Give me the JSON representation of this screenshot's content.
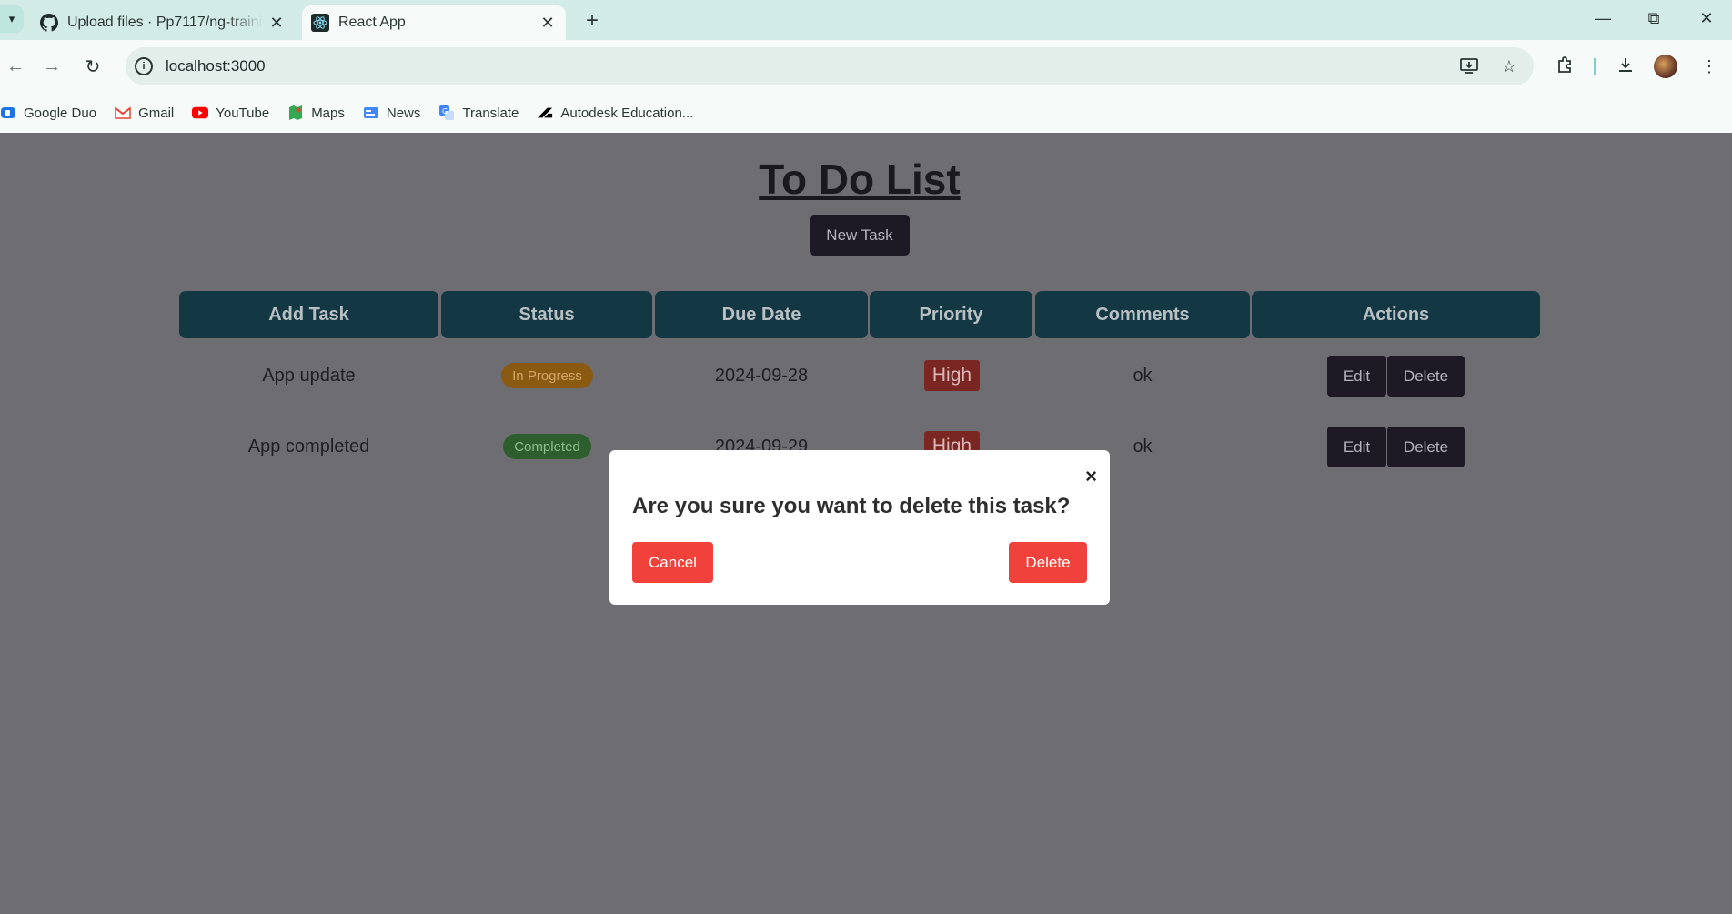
{
  "browser": {
    "tabs": [
      {
        "title": "Upload files · Pp7117/ng-trainin",
        "icon": "github-icon",
        "active": false
      },
      {
        "title": "React App",
        "icon": "react-icon",
        "active": true
      }
    ],
    "url": "localhost:3000",
    "bookmarks": [
      {
        "label": "Google Duo",
        "icon": "google-duo-icon",
        "color": "#1a73e8"
      },
      {
        "label": "Gmail",
        "icon": "gmail-icon",
        "color": "#ea4335"
      },
      {
        "label": "YouTube",
        "icon": "youtube-icon",
        "color": "#ff0000"
      },
      {
        "label": "Maps",
        "icon": "maps-icon",
        "color": "#34a853"
      },
      {
        "label": "News",
        "icon": "news-icon",
        "color": "#4285f4"
      },
      {
        "label": "Translate",
        "icon": "translate-icon",
        "color": "#4285f4"
      },
      {
        "label": "Autodesk Education...",
        "icon": "autodesk-icon",
        "color": "#000000"
      }
    ]
  },
  "app": {
    "title": "To Do List",
    "new_task_label": "New Task",
    "columns": [
      "Add Task",
      "Status",
      "Due Date",
      "Priority",
      "Comments",
      "Actions"
    ],
    "rows": [
      {
        "task": "App update",
        "status": "In Progress",
        "due": "2024-09-28",
        "priority": "High",
        "comments": "ok",
        "edit": "Edit",
        "delete": "Delete"
      },
      {
        "task": "App completed",
        "status": "Completed",
        "due": "2024-09-29",
        "priority": "High",
        "comments": "ok",
        "edit": "Edit",
        "delete": "Delete"
      }
    ]
  },
  "modal": {
    "close": "×",
    "message": "Are you sure you want to delete this task?",
    "cancel_label": "Cancel",
    "delete_label": "Delete"
  },
  "colors": {
    "overlay_bg": "#6e6e72",
    "header_bg": "#143744",
    "button_dark": "#1d1a26",
    "modal_button": "#f0413a",
    "status_in_progress": "#8a5a12",
    "status_completed": "#2e5e2e",
    "priority_high": "#7a2724"
  }
}
